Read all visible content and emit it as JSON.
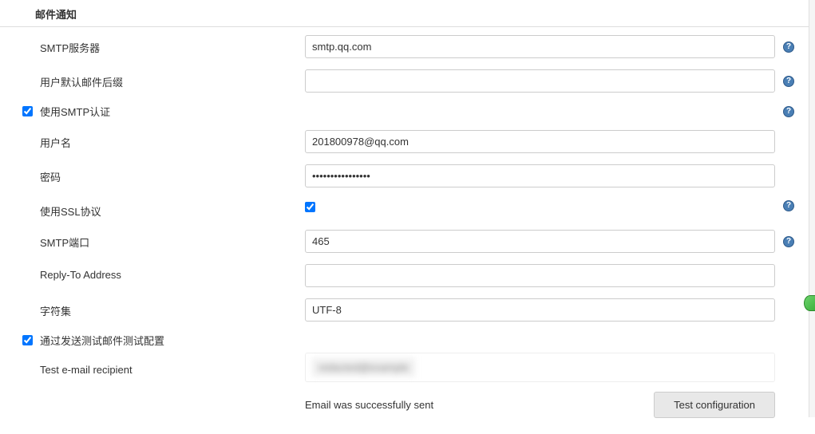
{
  "section_title": "邮件通知",
  "fields": {
    "smtp_server": {
      "label": "SMTP服务器",
      "value": "smtp.qq.com"
    },
    "default_suffix": {
      "label": "用户默认邮件后缀",
      "value": ""
    },
    "use_smtp_auth": {
      "label": "使用SMTP认证",
      "checked": true
    },
    "username": {
      "label": "用户名",
      "value": "201800978@qq.com"
    },
    "password": {
      "label": "密码",
      "value": "••••••••••••••••"
    },
    "use_ssl": {
      "label": "使用SSL协议",
      "checked": true
    },
    "smtp_port": {
      "label": "SMTP端口",
      "value": "465"
    },
    "reply_to": {
      "label": "Reply-To Address",
      "value": ""
    },
    "charset": {
      "label": "字符集",
      "value": "UTF-8"
    },
    "test_config": {
      "label": "通过发送测试邮件测试配置",
      "checked": true
    },
    "test_recipient": {
      "label": "Test e-mail recipient",
      "value": "redacted@example"
    }
  },
  "status_message": "Email was successfully sent",
  "test_button_label": "Test configuration",
  "help_icon_glyph": "?"
}
